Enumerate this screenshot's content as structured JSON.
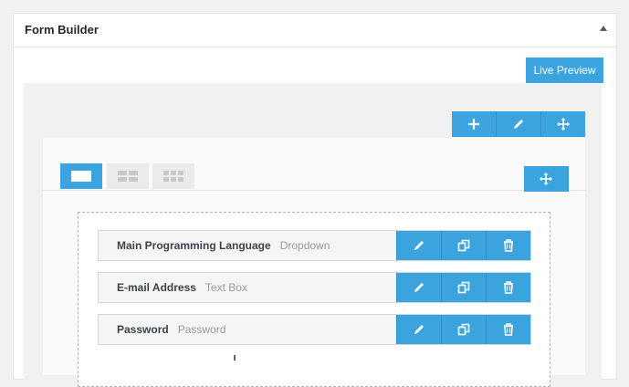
{
  "panel": {
    "title": "Form Builder"
  },
  "preview_button": {
    "label": "Live Preview"
  },
  "row_toolbar": [
    "plus-icon",
    "pencil-icon",
    "move-icon"
  ],
  "column_tabs": [
    "one-column-icon",
    "two-column-icon",
    "three-column-icon"
  ],
  "fields": [
    {
      "label": "Main Programming Language",
      "type": "Dropdown"
    },
    {
      "label": "E-mail Address",
      "type": "Text Box"
    },
    {
      "label": "Password",
      "type": "Password"
    }
  ],
  "field_actions": [
    "pencil-icon",
    "duplicate-icon",
    "trash-icon"
  ],
  "colors": {
    "accent": "#3ba4df",
    "background": "#f1f1f1",
    "panel": "#ffffff"
  }
}
